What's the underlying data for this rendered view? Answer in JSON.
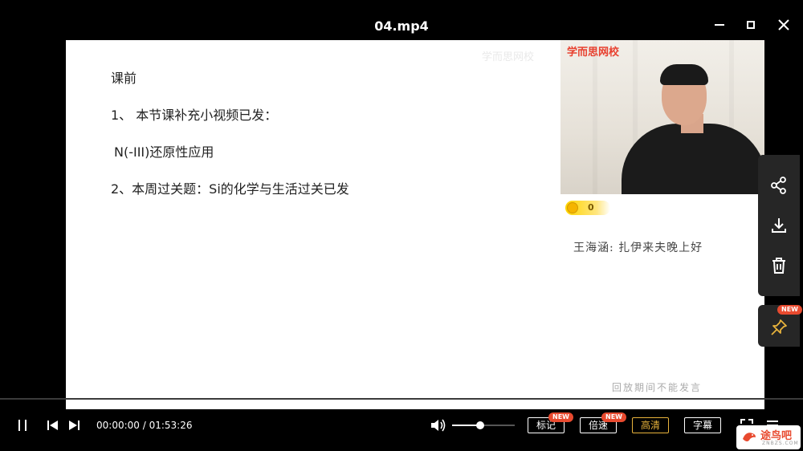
{
  "window": {
    "title": "04.mp4"
  },
  "slide": {
    "lines": [
      "课前",
      "1、 本节课补充小视频已发：",
      "N(-III)还原性应用",
      "2、本周过关题：Si的化学与生活过关已发"
    ],
    "watermark": "学而思网校"
  },
  "camera": {
    "brand": "学而思网校"
  },
  "chat": {
    "coin_count": "0",
    "message": "王海涵: 扎伊来夫晚上好",
    "replay_note": "回放期间不能发言"
  },
  "side_actions": {
    "new_badge": "NEW"
  },
  "player": {
    "time_current": "00:00:00",
    "time_separator": " / ",
    "time_total": "01:53:26",
    "volume_level": 0.45,
    "progress_fraction": 0.0,
    "buttons": {
      "mark": "标记",
      "speed": "倍速",
      "quality": "高清",
      "subtitle": "字幕"
    },
    "mark_badge": "NEW",
    "speed_badge": "NEW"
  },
  "logo": {
    "text": "途鸟吧",
    "sub": "ZNBZS.COM"
  },
  "colors": {
    "accent": "#e8b33c",
    "badge": "#e84a2f",
    "brand_red": "#e8402f"
  }
}
